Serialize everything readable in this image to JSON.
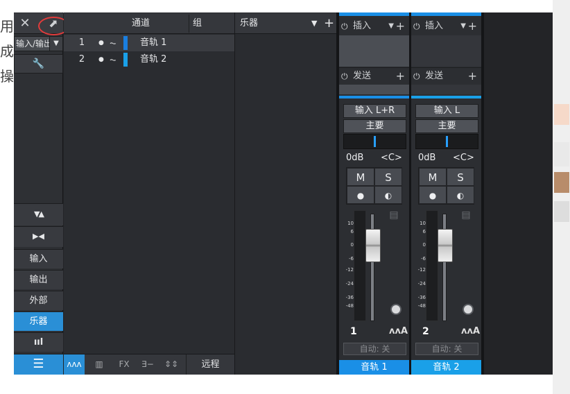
{
  "background_text": {
    "lines": [
      "用时",
      "成伯",
      "操作"
    ]
  },
  "window": {
    "close_label": "✕",
    "detach_label": "⬈",
    "left_panel": {
      "input_dropdown": "输入/输出",
      "wrench": "🔧",
      "buttons": [
        {
          "label": "输入"
        },
        {
          "label": "输出"
        },
        {
          "label": "外部"
        },
        {
          "label": "乐器",
          "selected": true
        },
        {
          "label": "ııl"
        },
        {
          "label": "☰",
          "selected": true
        }
      ],
      "expand_v": "▼▲",
      "expand_h": "▶◀"
    },
    "channel_list": {
      "header_channel": "通道",
      "header_group": "组",
      "tracks": [
        {
          "num": "1",
          "name": "音轨 1",
          "color": "#1a7fe0",
          "selected": true
        },
        {
          "num": "2",
          "name": "音轨 2",
          "color": "#1aa0e8",
          "selected": false
        }
      ],
      "bottom": {
        "wave": "ʌʌʌ",
        "piano": "▥",
        "fx": "FX",
        "send": "∃−",
        "adj": "⇕⇕",
        "remote": "远程"
      }
    },
    "instrument_panel": {
      "header": "乐器",
      "arrow": "▼",
      "plus": "+"
    },
    "channels": [
      {
        "insert_label": "插入",
        "send_label": "发送",
        "input": "输入 L+R",
        "output": "主要",
        "volume": "0dB",
        "pan": "<C>",
        "mute": "M",
        "solo": "S",
        "record": "●",
        "monitor": "◐",
        "number": "1",
        "wave": "ʌʌA",
        "automation": "自动: 关",
        "name": "音轨 1",
        "name_color": "#1a8fe6",
        "fader_level": 0.67
      },
      {
        "insert_label": "插入",
        "send_label": "发送",
        "input": "输入 L",
        "output": "主要",
        "volume": "0dB",
        "pan": "<C>",
        "mute": "M",
        "solo": "S",
        "record": "●",
        "monitor": "◐",
        "number": "2",
        "wave": "ʌʌA",
        "automation": "自动: 关",
        "name": "音轨 2",
        "name_color": "#1aa0e8",
        "fader_level": 0.67
      }
    ],
    "meter_scale": [
      "10",
      "6",
      "0",
      "-6",
      "-12",
      "-24",
      "-36",
      "-48"
    ],
    "power_icon": "⏻",
    "arrow_down": "▼",
    "plus": "+"
  }
}
